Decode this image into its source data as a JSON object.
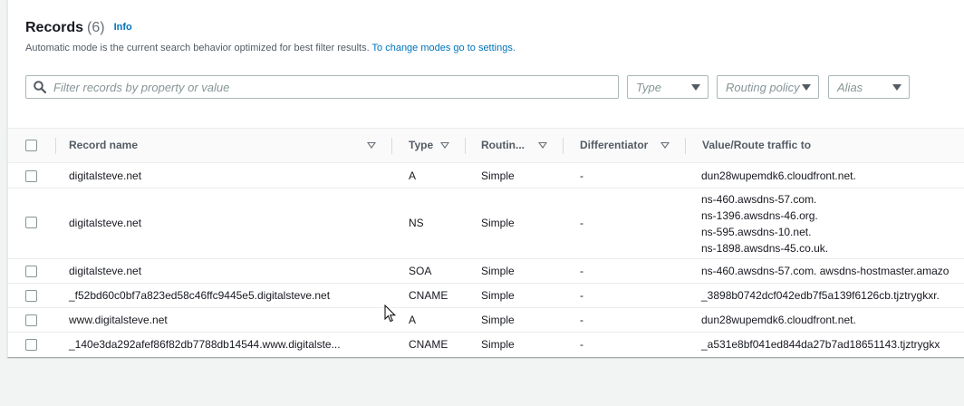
{
  "header": {
    "title": "Records",
    "count": "(6)",
    "info_label": "Info",
    "description": "Automatic mode is the current search behavior optimized for best filter results.",
    "settings_link": "To change modes go to settings."
  },
  "filters": {
    "search_placeholder": "Filter records by property or value",
    "type_placeholder": "Type",
    "routing_placeholder": "Routing policy",
    "alias_placeholder": "Alias"
  },
  "table": {
    "columns": [
      "Record name",
      "Type",
      "Routin...",
      "Differentiator",
      "Value/Route traffic to"
    ],
    "rows": [
      {
        "name": "digitalsteve.net",
        "type": "A",
        "routing": "Simple",
        "differentiator": "-",
        "value": [
          "dun28wupemdk6.cloudfront.net."
        ]
      },
      {
        "name": "digitalsteve.net",
        "type": "NS",
        "routing": "Simple",
        "differentiator": "-",
        "value": [
          "ns-460.awsdns-57.com.",
          "ns-1396.awsdns-46.org.",
          "ns-595.awsdns-10.net.",
          "ns-1898.awsdns-45.co.uk."
        ]
      },
      {
        "name": "digitalsteve.net",
        "type": "SOA",
        "routing": "Simple",
        "differentiator": "-",
        "value": [
          "ns-460.awsdns-57.com. awsdns-hostmaster.amazo"
        ]
      },
      {
        "name": "_f52bd60c0bf7a823ed58c46ffc9445e5.digitalsteve.net",
        "type": "CNAME",
        "routing": "Simple",
        "differentiator": "-",
        "value": [
          "_3898b0742dcf042edb7f5a139f6126cb.tjztrygkxr."
        ]
      },
      {
        "name": "www.digitalsteve.net",
        "type": "A",
        "routing": "Simple",
        "differentiator": "-",
        "value": [
          "dun28wupemdk6.cloudfront.net."
        ]
      },
      {
        "name": "_140e3da292afef86f82db7788db14544.www.digitalste...",
        "type": "CNAME",
        "routing": "Simple",
        "differentiator": "-",
        "value": [
          "_a531e8bf041ed844da27b7ad18651143.tjztrygkx"
        ]
      }
    ]
  },
  "colors": {
    "link": "#0073bb",
    "text": "#16191f",
    "muted": "#545b64",
    "border": "#eaeded"
  },
  "icons": {
    "search": "search-icon",
    "sort": "sort-caret-icon",
    "dropdown": "caret-down-icon"
  }
}
